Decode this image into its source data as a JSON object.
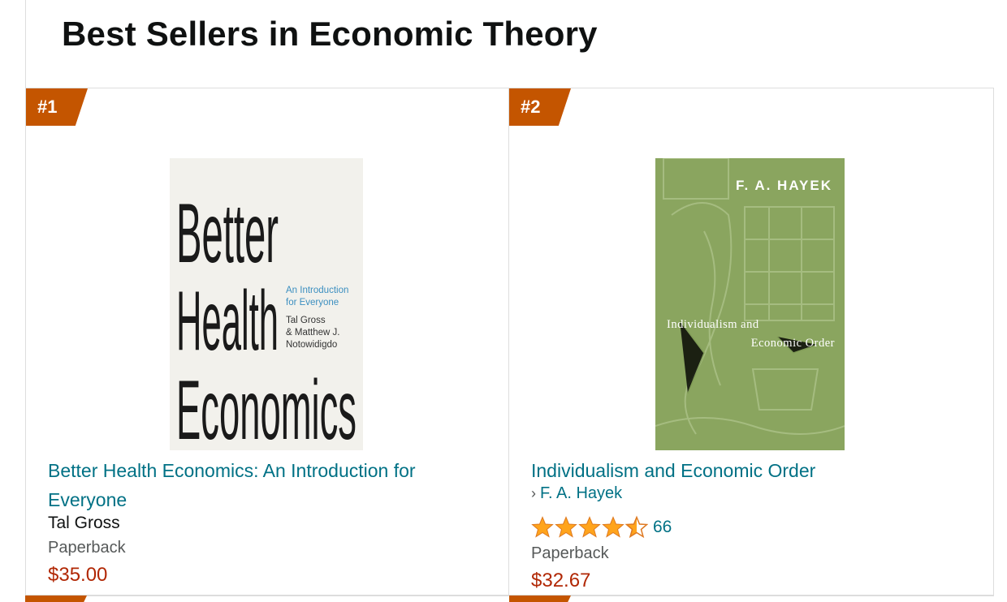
{
  "page": {
    "title": "Best Sellers in Economic Theory"
  },
  "items": [
    {
      "rank": "#1",
      "title": "Better Health Economics: An Introduction for Everyone",
      "author": "Tal Gross",
      "format": "Paperback",
      "price": "$35.00",
      "cover": {
        "line1": "Better",
        "line2": "Health",
        "line3": "Economics",
        "subtitle1": "An Introduction",
        "subtitle2": "for Everyone",
        "author1": "Tal Gross",
        "author2": "& Matthew J.",
        "author3": "Notowidigdo"
      }
    },
    {
      "rank": "#2",
      "title": "Individualism and Economic Order",
      "author": "F. A. Hayek",
      "rating_value": 4.5,
      "rating_count": "66",
      "format": "Paperback",
      "price": "$32.67",
      "cover": {
        "author": "F. A. HAYEK",
        "title1": "Individualism and",
        "title2": "Economic Order"
      }
    }
  ],
  "colors": {
    "badge": "#c45500",
    "link": "#007185",
    "price": "#b12704",
    "star": "#ffa41c",
    "cover2_green": "#8aa55f"
  }
}
